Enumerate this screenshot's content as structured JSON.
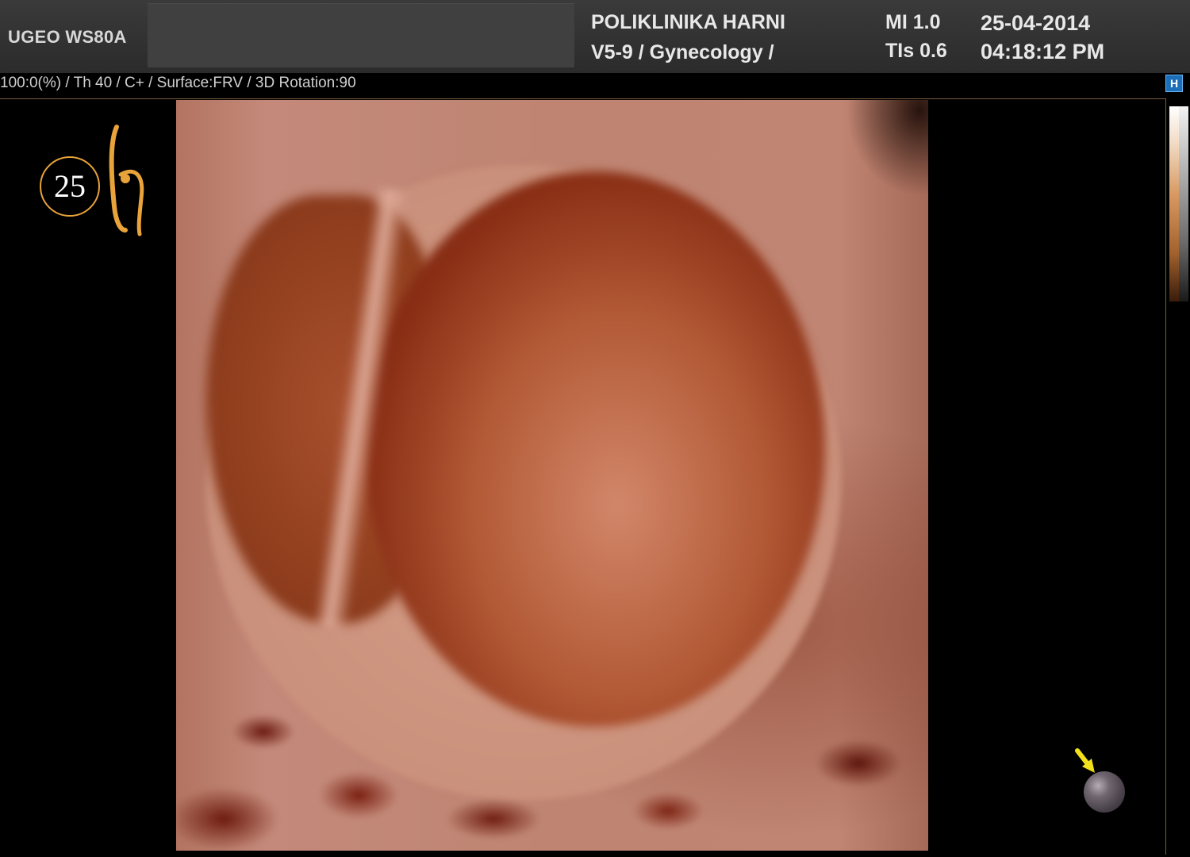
{
  "header": {
    "device": "UGEO WS80A",
    "clinic": "POLIKLINIKA HARNI",
    "probe_preset": "V5-9 / Gynecology /",
    "mi": "MI  1.0",
    "tis": "TIs 0.6",
    "date": "25-04-2014",
    "time": "04:18:12 PM"
  },
  "params_line": "100:0(%) / Th 40 / C+ / Surface:FRV / 3D Rotation:90",
  "h_button_label": "H",
  "logo": {
    "number": "25"
  },
  "colors": {
    "header_bg": "#2f2f2f",
    "accent_logo": "#e8a33a",
    "marker_arrow": "#f2e01a",
    "render_tissue": "#c08573",
    "render_cavity": "#8a2f15"
  },
  "icons": {
    "h_button": "h-square-icon",
    "orientation_marker": "orientation-ball-icon",
    "orientation_arrow": "arrow-down-right-icon"
  }
}
